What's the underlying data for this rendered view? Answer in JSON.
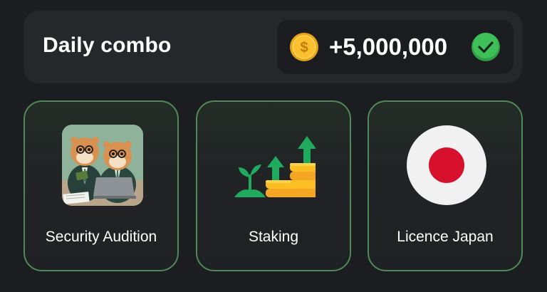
{
  "header": {
    "title": "Daily combo",
    "reward_amount": "+5,000,000",
    "coin_icon": "dollar-coin-icon",
    "status_icon": "checkmark-icon"
  },
  "cards": [
    {
      "label": "Security Audition",
      "image": "hamsters-meeting-image"
    },
    {
      "label": "Staking",
      "image": "growing-coins-icon"
    },
    {
      "label": "Licence Japan",
      "image": "japan-flag-icon"
    }
  ],
  "colors": {
    "background": "#1c1d20",
    "panel": "#26272b",
    "accent_green": "#22c55e",
    "coin_gold": "#f7b924",
    "japan_red": "#d7102e"
  }
}
